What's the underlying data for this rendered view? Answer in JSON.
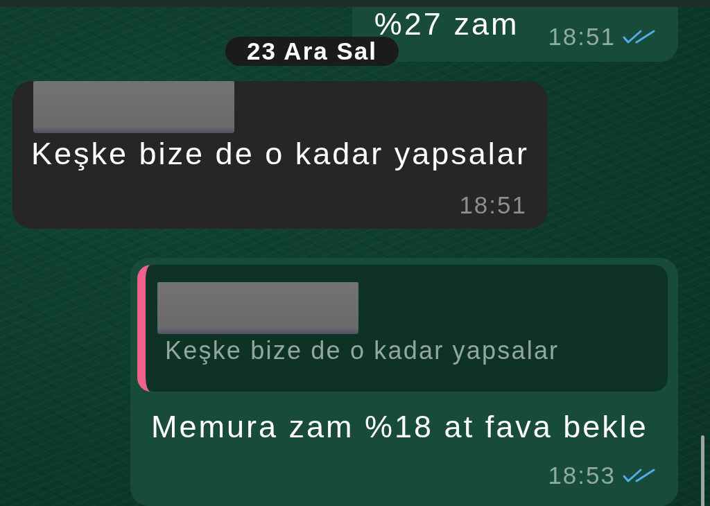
{
  "messages": [
    {
      "kind": "outgoing",
      "text": "%27 zam",
      "time": "18:51",
      "read": true
    },
    {
      "kind": "date",
      "text": "23 Ara Sal"
    },
    {
      "kind": "incoming",
      "redacted_sender": true,
      "text": "Keşke bize de o kadar yapsalar",
      "time": "18:51"
    },
    {
      "kind": "outgoing",
      "reply": {
        "redacted_sender": true,
        "text": "Keşke bize de o kadar yapsalar"
      },
      "text": "Memura zam %18 at fava bekle",
      "time": "18:53",
      "read": true
    }
  ]
}
